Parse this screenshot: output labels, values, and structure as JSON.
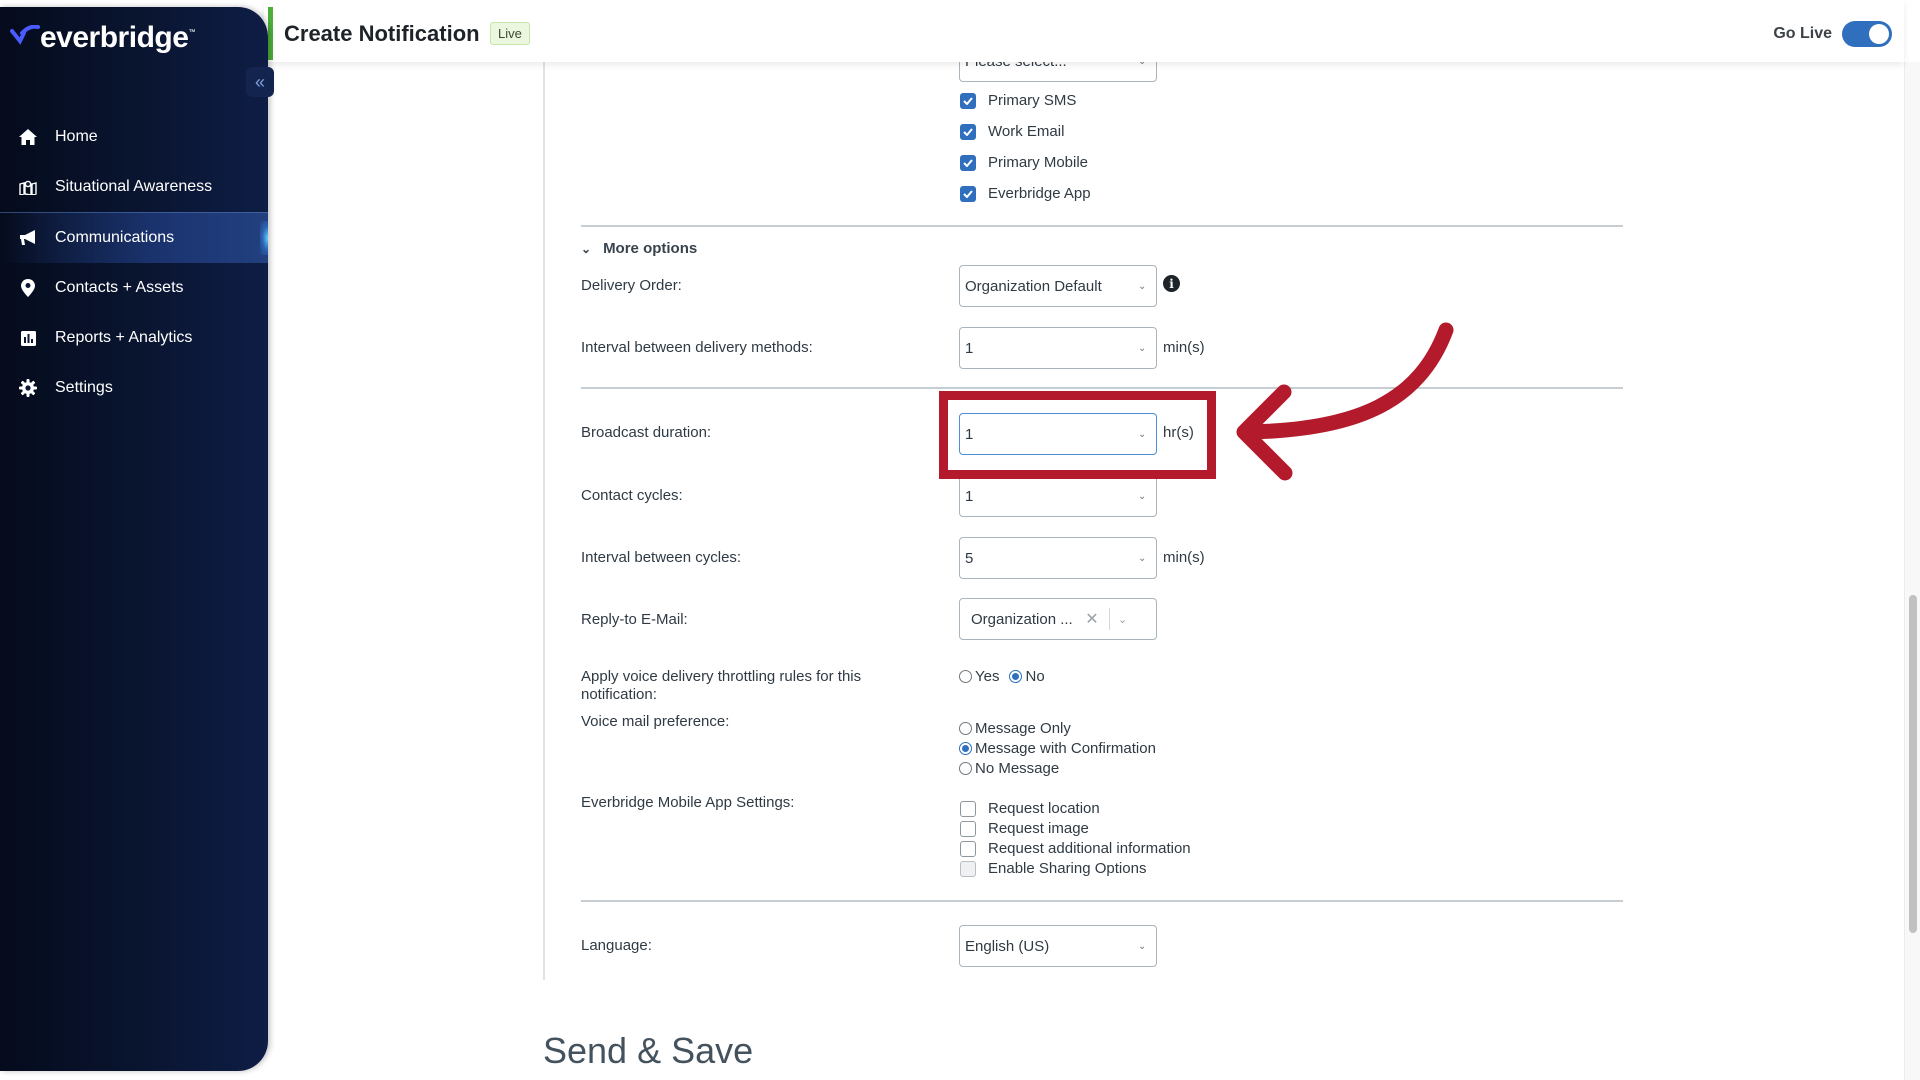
{
  "sidebar": {
    "logo_text": "everbridge",
    "logo_tm": "™",
    "collapse_label": "«",
    "items": [
      {
        "label": "Home",
        "icon": "home-icon",
        "active": false
      },
      {
        "label": "Situational Awareness",
        "icon": "map-icon",
        "active": false
      },
      {
        "label": "Communications",
        "icon": "megaphone-icon",
        "active": true
      },
      {
        "label": "Contacts + Assets",
        "icon": "location-pin-icon",
        "active": false
      },
      {
        "label": "Reports + Analytics",
        "icon": "bar-chart-icon",
        "active": false
      },
      {
        "label": "Settings",
        "icon": "gear-icon",
        "active": false
      }
    ]
  },
  "header": {
    "title": "Create Notification",
    "badge": "Live",
    "go_live_label": "Go Live",
    "go_live_on": true,
    "accent_color": "#4caf3a"
  },
  "form": {
    "top_select_placeholder": "Please select...",
    "delivery_methods": [
      {
        "label": "Primary SMS",
        "checked": true
      },
      {
        "label": "Work Email",
        "checked": true
      },
      {
        "label": "Primary Mobile",
        "checked": true
      },
      {
        "label": "Everbridge App",
        "checked": true
      }
    ],
    "more_options_label": "More options",
    "delivery_order": {
      "label": "Delivery Order:",
      "value": "Organization Default"
    },
    "interval_methods": {
      "label": "Interval between delivery methods:",
      "value": "1",
      "unit": "min(s)"
    },
    "broadcast_duration": {
      "label": "Broadcast duration:",
      "value": "1",
      "unit": "hr(s)"
    },
    "contact_cycles": {
      "label": "Contact cycles:",
      "value": "1"
    },
    "interval_cycles": {
      "label": "Interval between cycles:",
      "value": "5",
      "unit": "min(s)"
    },
    "reply_to": {
      "label": "Reply-to E-Mail:",
      "value": "Organization ...",
      "clear": "✕"
    },
    "voice_throttling": {
      "label": "Apply voice delivery throttling rules for this notification:",
      "options": [
        {
          "label": "Yes",
          "selected": false
        },
        {
          "label": "No",
          "selected": true
        }
      ]
    },
    "voice_mail": {
      "label": "Voice mail preference:",
      "options": [
        {
          "label": "Message Only",
          "selected": false
        },
        {
          "label": "Message with Confirmation",
          "selected": true
        },
        {
          "label": "No Message",
          "selected": false
        }
      ]
    },
    "mobile_app": {
      "label": "Everbridge Mobile App Settings:",
      "options": [
        {
          "label": "Request location",
          "checked": false
        },
        {
          "label": "Request image",
          "checked": false
        },
        {
          "label": "Request additional information",
          "checked": false
        },
        {
          "label": "Enable Sharing Options",
          "checked": false,
          "disabled": true
        }
      ]
    },
    "language": {
      "label": "Language:",
      "value": "English (US)"
    }
  },
  "send_save_title": "Send & Save",
  "annotation": {
    "color": "#b31b2c",
    "target": "broadcast-duration-select"
  }
}
